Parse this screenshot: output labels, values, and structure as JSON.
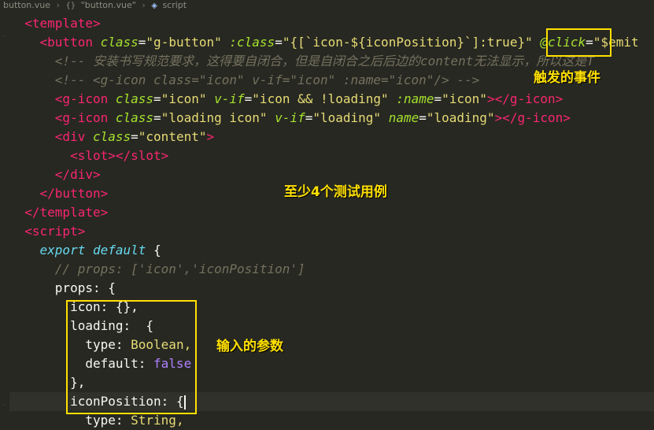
{
  "breadcrumb": {
    "file": "button.vue",
    "scope": "\"button.vue\"",
    "section": "script"
  },
  "code": {
    "l1": "<template>",
    "l2a": "<button",
    "l2b": "class",
    "l2c": "\"g-button\"",
    "l2d": ":class",
    "l2e": "\"{[`icon-${iconPosition}`]:true}\"",
    "l2f": "@click",
    "l2g": "\"$emit",
    "l3": "<!-- 安装书写规范要求，这得要自闭合，但是自闭合之后后边的content无法显示，所以这是T",
    "l4": "<!-- <g-icon class=\"icon\" v-if=\"icon\" :name=\"icon\"/> -->",
    "l5a": "<g-icon",
    "l5b": "class",
    "l5c": "\"icon\"",
    "l5d": "v-if",
    "l5e": "\"icon && !loading\"",
    "l5f": ":name",
    "l5g": "\"icon\"",
    "l5h": "></g-icon>",
    "l6a": "<g-icon",
    "l6b": "class",
    "l6c": "\"loading icon\"",
    "l6d": "v-if",
    "l6e": "\"loading\"",
    "l6f": "name",
    "l6g": "\"loading\"",
    "l6h": "></g-icon>",
    "l7a": "<div",
    "l7b": "class",
    "l7c": "\"content\"",
    "l7d": ">",
    "l8": "<slot></slot>",
    "l9": "</div>",
    "l10": "</button>",
    "l11": "</template>",
    "l12": "<script>",
    "l13a": "export",
    "l13b": "default",
    "l13c": "{",
    "l14": "// props: ['icon','iconPosition']",
    "l15": "props: {",
    "l16": "icon: {},",
    "l17": "loading:  {",
    "l18a": "type:",
    "l18b": "Boolean,",
    "l19a": "default:",
    "l19b": "false",
    "l20": "},",
    "l21a": "iconPosition:",
    "l21b": "{",
    "l22a": "type:",
    "l22b": "String,"
  },
  "annotations": {
    "event": "触发的事件",
    "tests": "至少4个测试用例",
    "params": "输入的参数"
  },
  "colors": {
    "background": "#272822",
    "highlight": "#ffe000"
  }
}
